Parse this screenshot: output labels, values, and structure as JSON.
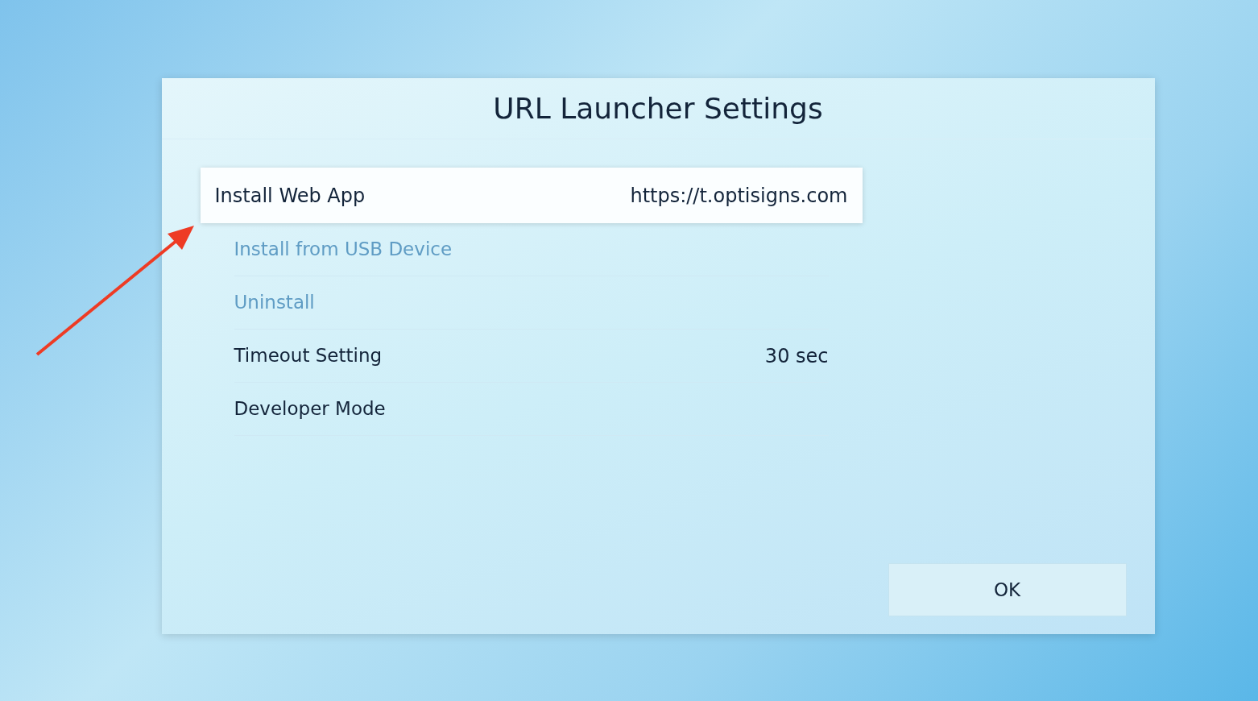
{
  "dialog": {
    "title": "URL Launcher Settings",
    "items": [
      {
        "label": "Install Web App",
        "value": "https://t.optisigns.com",
        "selected": true,
        "disabled": false
      },
      {
        "label": "Install from USB Device",
        "selected": false,
        "disabled": true
      },
      {
        "label": "Uninstall",
        "selected": false,
        "disabled": true
      },
      {
        "label": "Timeout Setting",
        "value": "30 sec",
        "selected": false,
        "disabled": false
      },
      {
        "label": "Developer Mode",
        "selected": false,
        "disabled": false
      }
    ],
    "ok_button": "OK"
  }
}
